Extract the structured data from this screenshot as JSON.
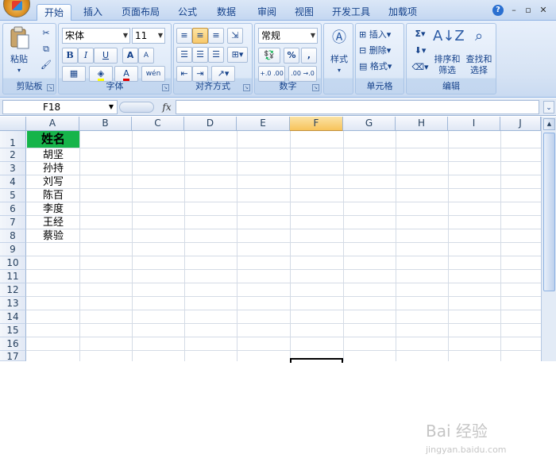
{
  "tabs": [
    "开始",
    "插入",
    "页面布局",
    "公式",
    "数据",
    "审阅",
    "视图",
    "开发工具",
    "加载项"
  ],
  "window": {
    "help": "?",
    "minimize": "–",
    "restore": "▫",
    "close": "✕"
  },
  "clipboard": {
    "paste_label": "粘贴",
    "group_label": "剪贴板"
  },
  "font": {
    "name": "宋体",
    "size": "11",
    "group_label": "字体",
    "bold": "B",
    "italic": "I",
    "underline": "U",
    "grow": "A",
    "shrink": "A",
    "wen": "wén",
    "font_color_letter": "A"
  },
  "alignment": {
    "group_label": "对齐方式"
  },
  "number": {
    "format": "常规",
    "group_label": "数字",
    "percent": "%",
    "comma": ",",
    "inc_decimal": "+.0 .00",
    "dec_decimal": ".00 →.0"
  },
  "styles": {
    "label": "样式"
  },
  "cells": {
    "insert": "插入",
    "delete": "删除",
    "format": "格式",
    "group_label": "单元格"
  },
  "editing": {
    "sum": "Σ",
    "sort_line1": "排序和",
    "sort_line2": "筛选",
    "find_line1": "查找和",
    "find_line2": "选择",
    "group_label": "编辑"
  },
  "formula_bar": {
    "name_box": "F18",
    "fx": "fx",
    "value": ""
  },
  "columns": [
    "A",
    "B",
    "C",
    "D",
    "E",
    "F",
    "G",
    "H",
    "I",
    "J"
  ],
  "selected_column": "F",
  "rows": [
    "1",
    "2",
    "3",
    "4",
    "5",
    "6",
    "7",
    "8",
    "9",
    "10",
    "11",
    "12",
    "13",
    "14",
    "15",
    "16",
    "17"
  ],
  "cells_data": {
    "A1": "姓名",
    "A2": "胡坚",
    "A3": "孙持",
    "A4": "刘写",
    "A5": "陈百",
    "A6": "李度",
    "A7": "王经",
    "A8": "蔡验"
  },
  "colors": {
    "header_fill": "#16b44a",
    "ribbon_accent": "#15428b",
    "selected_header": "#f7c35b"
  },
  "watermark": {
    "main": "Bai 经验",
    "sub": "jingyan.baidu.com"
  }
}
